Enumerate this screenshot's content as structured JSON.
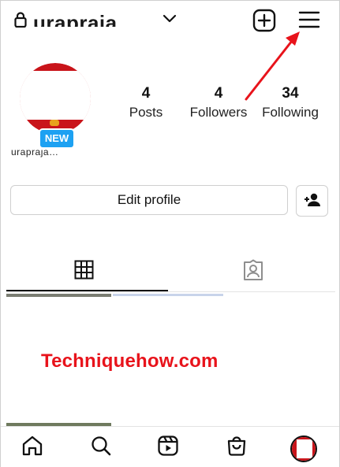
{
  "header": {
    "username": "urapraja…",
    "icons": [
      "lock-icon",
      "chevron-down-icon",
      "new-post-icon",
      "menu-icon"
    ]
  },
  "profile": {
    "new_badge": "NEW",
    "name": "urapraja…",
    "stats": [
      {
        "value": "4",
        "label": "Posts"
      },
      {
        "value": "4",
        "label": "Followers"
      },
      {
        "value": "34",
        "label": "Following"
      }
    ]
  },
  "actions": {
    "edit_profile": "Edit profile",
    "add_person_icon": "person-add-icon"
  },
  "tabs": [
    {
      "name": "grid-icon",
      "selected": true
    },
    {
      "name": "tagged-icon",
      "selected": false
    }
  ],
  "watermark": "Techniquehow.com",
  "bottom_nav": [
    "home-icon",
    "search-icon",
    "reels-icon",
    "shop-icon",
    "profile-avatar"
  ],
  "colors": {
    "annotation_arrow": "#e8131b",
    "new_badge": "#1da1f2",
    "avatar_red": "#c9141a"
  }
}
